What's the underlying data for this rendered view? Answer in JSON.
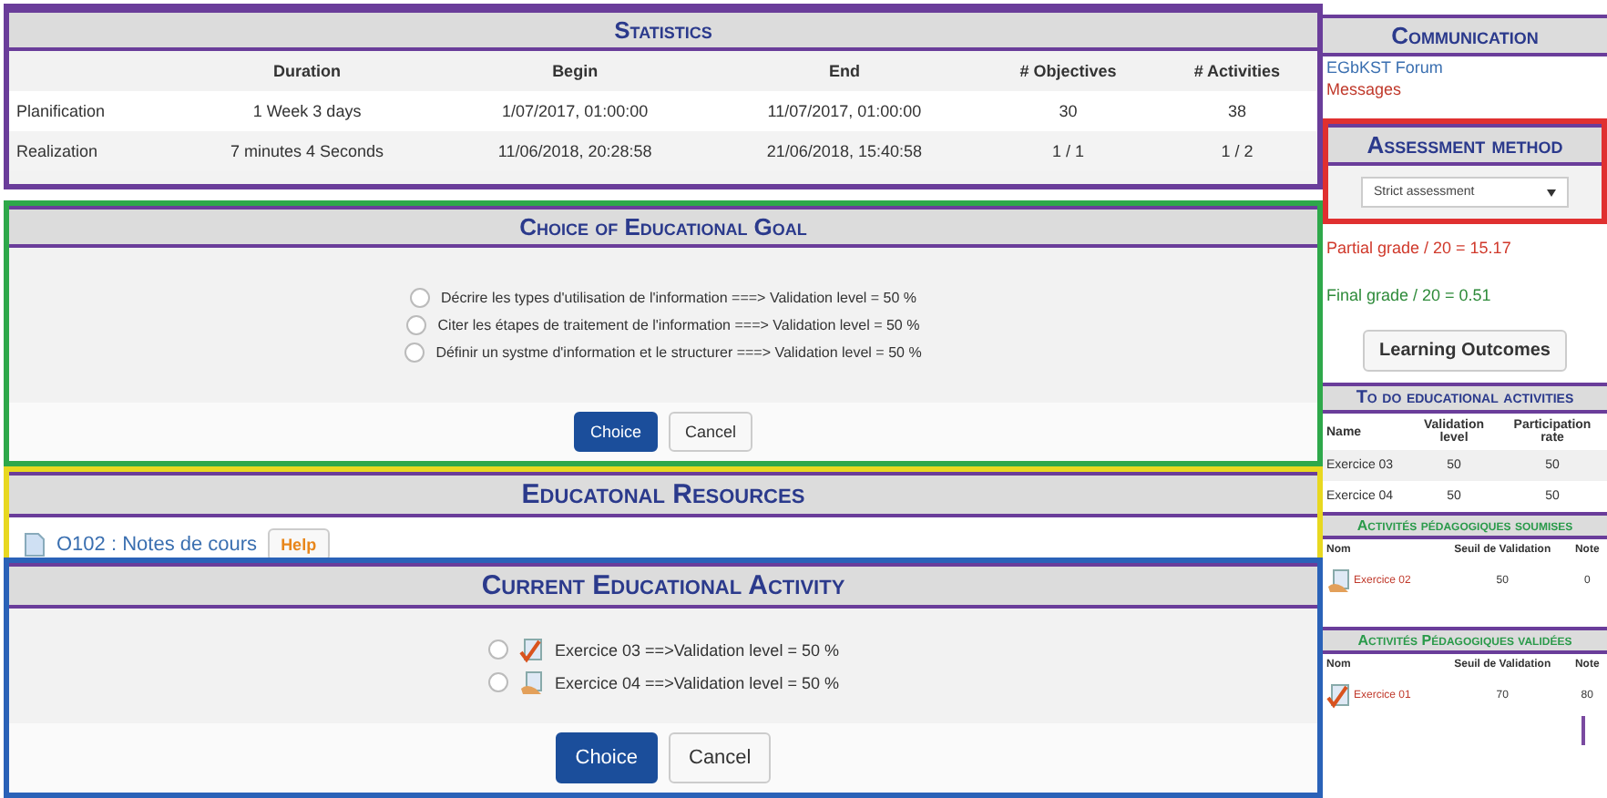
{
  "statistics": {
    "title": "Statistics",
    "columns": [
      "Duration",
      "Begin",
      "End",
      "# Objectives",
      "# Activities"
    ],
    "rows": [
      {
        "label": "Planification",
        "cells": [
          "1 Week 3 days",
          "1/07/2017, 01:00:00",
          "11/07/2017, 01:00:00",
          "30",
          "38"
        ]
      },
      {
        "label": "Realization",
        "cells": [
          "7 minutes 4 Seconds",
          "11/06/2018, 20:28:58",
          "21/06/2018, 15:40:58",
          "1 / 1",
          "1 / 2"
        ]
      }
    ]
  },
  "goal": {
    "title": "Choice of Educational Goal",
    "options": [
      {
        "label": "Décrire les types d'utilisation de l'information ===> Validation level = 50 %",
        "selected": false
      },
      {
        "label": "Citer les étapes de traitement de l'information ===> Validation level = 50 %",
        "selected": false
      },
      {
        "label": "Définir un systme d'information et le structurer ===> Validation level = 50 %",
        "selected": false
      }
    ],
    "buttons": [
      {
        "label": "Choice",
        "kind": "primary"
      },
      {
        "label": "Cancel",
        "kind": "default"
      }
    ]
  },
  "resources": {
    "title": "Educatonal Resources",
    "items": [
      {
        "label": "O102 : Notes de cours"
      }
    ],
    "help": "Help"
  },
  "activity": {
    "title": "Current Educational Activity",
    "options": [
      {
        "label": "Exercice 03 ==>Validation level = 50 %",
        "kind": "validated",
        "selected": false
      },
      {
        "label": "Exercice 04 ==>Validation level = 50 %",
        "kind": "submitted",
        "selected": false
      }
    ],
    "buttons": [
      {
        "label": "Choice",
        "kind": "primary"
      },
      {
        "label": "Cancel",
        "kind": "default"
      }
    ]
  },
  "communication": {
    "title": "Communication",
    "links": [
      {
        "label": "EGbKST Forum",
        "kind": "forum"
      },
      {
        "label": "Messages",
        "kind": "messages"
      }
    ]
  },
  "assessment": {
    "title": "Assessment method",
    "value": "Strict assessment"
  },
  "grades": [
    {
      "label": "Partial grade / 20 = 15.17",
      "kind": "partial"
    },
    {
      "label": "Final grade / 20 = 0.51",
      "kind": "final"
    }
  ],
  "learning_outcomes": "Learning Outcomes",
  "todo": {
    "title": "To do educational activities",
    "columns": [
      "Name",
      "Validation level",
      "Participation rate"
    ],
    "rows": [
      {
        "cells": [
          "Exercice 03",
          "50",
          "50"
        ]
      },
      {
        "cells": [
          "Exercice 04",
          "50",
          "50"
        ]
      }
    ]
  },
  "tables": [
    {
      "title": "Activités pédagogiques soumises",
      "columns": [
        "Nom",
        "Seuil de Validation",
        "Note"
      ],
      "rows": [
        {
          "kind": "submitted",
          "cells": [
            "Exercice 02",
            "50",
            "0"
          ]
        }
      ]
    },
    {
      "title": "Activités Pédagogiques validées",
      "columns": [
        "Nom",
        "Seuil de Validation",
        "Note"
      ],
      "rows": [
        {
          "kind": "validated",
          "cells": [
            "Exercice 01",
            "70",
            "80"
          ]
        }
      ]
    }
  ]
}
